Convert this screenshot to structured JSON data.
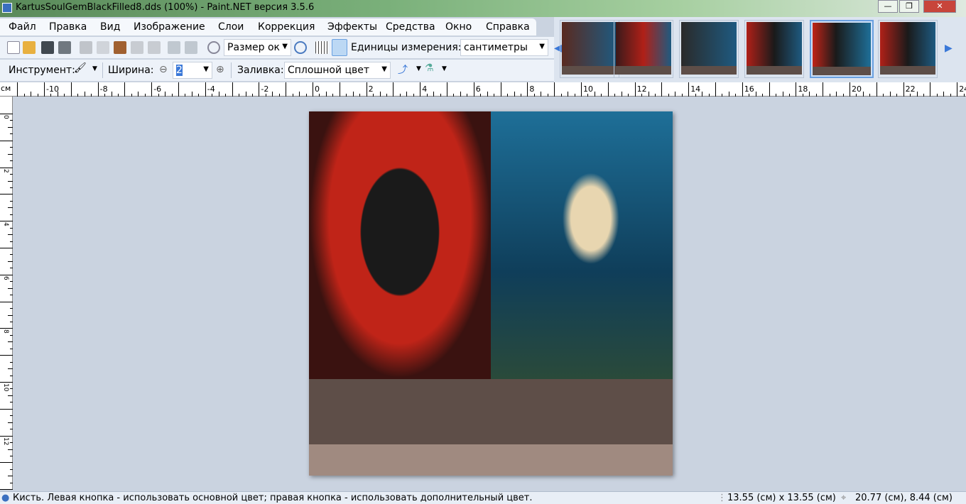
{
  "window": {
    "title": "KartusSoulGemBlackFilled8.dds (100%) - Paint.NET версия 3.5.6"
  },
  "menu": [
    "Файл",
    "Правка",
    "Вид",
    "Изображение",
    "Слои",
    "Коррекция",
    "Эффекты",
    "Средства",
    "Окно",
    "Справка"
  ],
  "toolbar": {
    "zoom_select": "Размер ок",
    "units_label": "Единицы измерения:",
    "units_value": "сантиметры"
  },
  "toolbar2": {
    "tool_label": "Инструмент:",
    "width_label": "Ширина:",
    "width_value": "2",
    "fill_label": "Заливка:",
    "fill_value": "Сплошной цвет"
  },
  "ruler": {
    "unit": "см",
    "h_labels": [
      "-10",
      "-8",
      "-6",
      "-4",
      "-2",
      "0",
      "2",
      "4",
      "6",
      "8",
      "10",
      "12",
      "14",
      "16",
      "18",
      "20",
      "22",
      "24"
    ],
    "v_labels": [
      "0",
      "2",
      "4",
      "6",
      "8",
      "10",
      "12"
    ]
  },
  "thumbnails": {
    "count": 6,
    "selected_index": 4
  },
  "status": {
    "hint": "Кисть. Левая кнопка - использовать основной цвет; правая кнопка - использовать дополнительный цвет.",
    "size": "13.55 (см) x 13.55 (см)",
    "position": "20.77 (см), 8.44 (см)"
  },
  "colors": {
    "canvas_bg": "#cad3e0",
    "brown_band": "#5e4e48",
    "tan_band": "#a08a80",
    "selection": "#6aa0e0"
  }
}
